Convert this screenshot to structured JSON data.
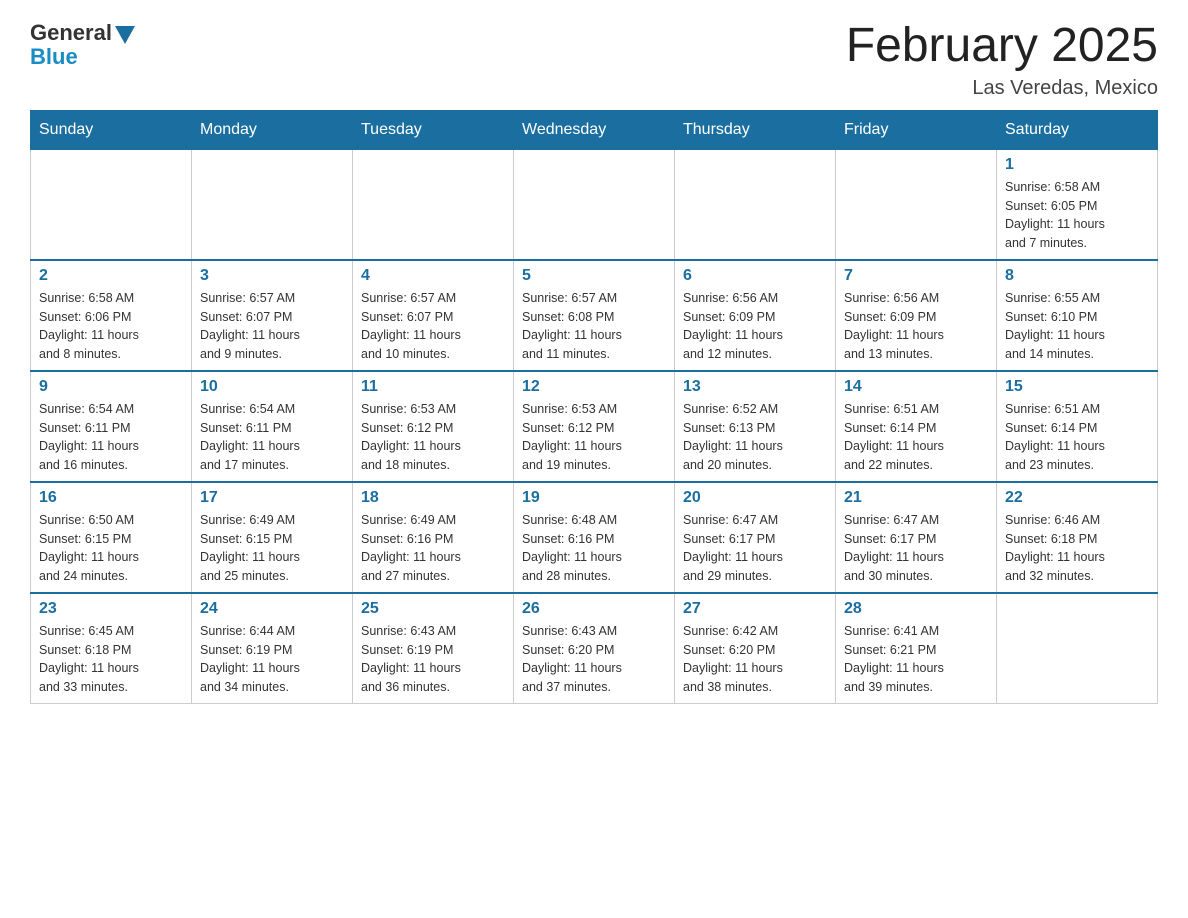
{
  "logo": {
    "general": "General",
    "blue": "Blue"
  },
  "title": "February 2025",
  "location": "Las Veredas, Mexico",
  "days_of_week": [
    "Sunday",
    "Monday",
    "Tuesday",
    "Wednesday",
    "Thursday",
    "Friday",
    "Saturday"
  ],
  "weeks": [
    [
      {
        "day": "",
        "info": ""
      },
      {
        "day": "",
        "info": ""
      },
      {
        "day": "",
        "info": ""
      },
      {
        "day": "",
        "info": ""
      },
      {
        "day": "",
        "info": ""
      },
      {
        "day": "",
        "info": ""
      },
      {
        "day": "1",
        "info": "Sunrise: 6:58 AM\nSunset: 6:05 PM\nDaylight: 11 hours\nand 7 minutes."
      }
    ],
    [
      {
        "day": "2",
        "info": "Sunrise: 6:58 AM\nSunset: 6:06 PM\nDaylight: 11 hours\nand 8 minutes."
      },
      {
        "day": "3",
        "info": "Sunrise: 6:57 AM\nSunset: 6:07 PM\nDaylight: 11 hours\nand 9 minutes."
      },
      {
        "day": "4",
        "info": "Sunrise: 6:57 AM\nSunset: 6:07 PM\nDaylight: 11 hours\nand 10 minutes."
      },
      {
        "day": "5",
        "info": "Sunrise: 6:57 AM\nSunset: 6:08 PM\nDaylight: 11 hours\nand 11 minutes."
      },
      {
        "day": "6",
        "info": "Sunrise: 6:56 AM\nSunset: 6:09 PM\nDaylight: 11 hours\nand 12 minutes."
      },
      {
        "day": "7",
        "info": "Sunrise: 6:56 AM\nSunset: 6:09 PM\nDaylight: 11 hours\nand 13 minutes."
      },
      {
        "day": "8",
        "info": "Sunrise: 6:55 AM\nSunset: 6:10 PM\nDaylight: 11 hours\nand 14 minutes."
      }
    ],
    [
      {
        "day": "9",
        "info": "Sunrise: 6:54 AM\nSunset: 6:11 PM\nDaylight: 11 hours\nand 16 minutes."
      },
      {
        "day": "10",
        "info": "Sunrise: 6:54 AM\nSunset: 6:11 PM\nDaylight: 11 hours\nand 17 minutes."
      },
      {
        "day": "11",
        "info": "Sunrise: 6:53 AM\nSunset: 6:12 PM\nDaylight: 11 hours\nand 18 minutes."
      },
      {
        "day": "12",
        "info": "Sunrise: 6:53 AM\nSunset: 6:12 PM\nDaylight: 11 hours\nand 19 minutes."
      },
      {
        "day": "13",
        "info": "Sunrise: 6:52 AM\nSunset: 6:13 PM\nDaylight: 11 hours\nand 20 minutes."
      },
      {
        "day": "14",
        "info": "Sunrise: 6:51 AM\nSunset: 6:14 PM\nDaylight: 11 hours\nand 22 minutes."
      },
      {
        "day": "15",
        "info": "Sunrise: 6:51 AM\nSunset: 6:14 PM\nDaylight: 11 hours\nand 23 minutes."
      }
    ],
    [
      {
        "day": "16",
        "info": "Sunrise: 6:50 AM\nSunset: 6:15 PM\nDaylight: 11 hours\nand 24 minutes."
      },
      {
        "day": "17",
        "info": "Sunrise: 6:49 AM\nSunset: 6:15 PM\nDaylight: 11 hours\nand 25 minutes."
      },
      {
        "day": "18",
        "info": "Sunrise: 6:49 AM\nSunset: 6:16 PM\nDaylight: 11 hours\nand 27 minutes."
      },
      {
        "day": "19",
        "info": "Sunrise: 6:48 AM\nSunset: 6:16 PM\nDaylight: 11 hours\nand 28 minutes."
      },
      {
        "day": "20",
        "info": "Sunrise: 6:47 AM\nSunset: 6:17 PM\nDaylight: 11 hours\nand 29 minutes."
      },
      {
        "day": "21",
        "info": "Sunrise: 6:47 AM\nSunset: 6:17 PM\nDaylight: 11 hours\nand 30 minutes."
      },
      {
        "day": "22",
        "info": "Sunrise: 6:46 AM\nSunset: 6:18 PM\nDaylight: 11 hours\nand 32 minutes."
      }
    ],
    [
      {
        "day": "23",
        "info": "Sunrise: 6:45 AM\nSunset: 6:18 PM\nDaylight: 11 hours\nand 33 minutes."
      },
      {
        "day": "24",
        "info": "Sunrise: 6:44 AM\nSunset: 6:19 PM\nDaylight: 11 hours\nand 34 minutes."
      },
      {
        "day": "25",
        "info": "Sunrise: 6:43 AM\nSunset: 6:19 PM\nDaylight: 11 hours\nand 36 minutes."
      },
      {
        "day": "26",
        "info": "Sunrise: 6:43 AM\nSunset: 6:20 PM\nDaylight: 11 hours\nand 37 minutes."
      },
      {
        "day": "27",
        "info": "Sunrise: 6:42 AM\nSunset: 6:20 PM\nDaylight: 11 hours\nand 38 minutes."
      },
      {
        "day": "28",
        "info": "Sunrise: 6:41 AM\nSunset: 6:21 PM\nDaylight: 11 hours\nand 39 minutes."
      },
      {
        "day": "",
        "info": ""
      }
    ]
  ]
}
